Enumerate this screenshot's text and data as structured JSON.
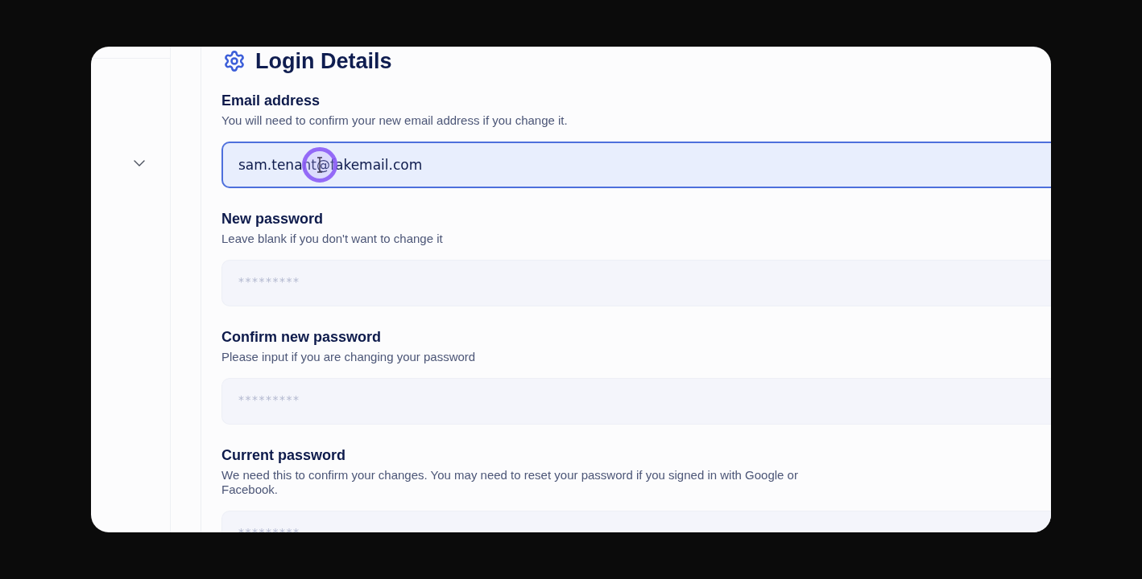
{
  "header": {
    "title": "Login Details"
  },
  "fields": [
    {
      "label": "Email address",
      "description": "You will need to confirm your new email address if you change it.",
      "value": "sam.tenant@fakemail.com",
      "focused": true
    },
    {
      "label": "New password",
      "description": "Leave blank if you don't want to change it",
      "placeholder": "*********",
      "focused": false
    },
    {
      "label": "Confirm new password",
      "description": "Please input if you are changing your password",
      "placeholder": "*********",
      "focused": false
    },
    {
      "label": "Current password",
      "description": "We need this to confirm your changes. You may need to reset your password if you signed in with Google or Facebook.",
      "placeholder": "*********",
      "focused": false
    }
  ]
}
